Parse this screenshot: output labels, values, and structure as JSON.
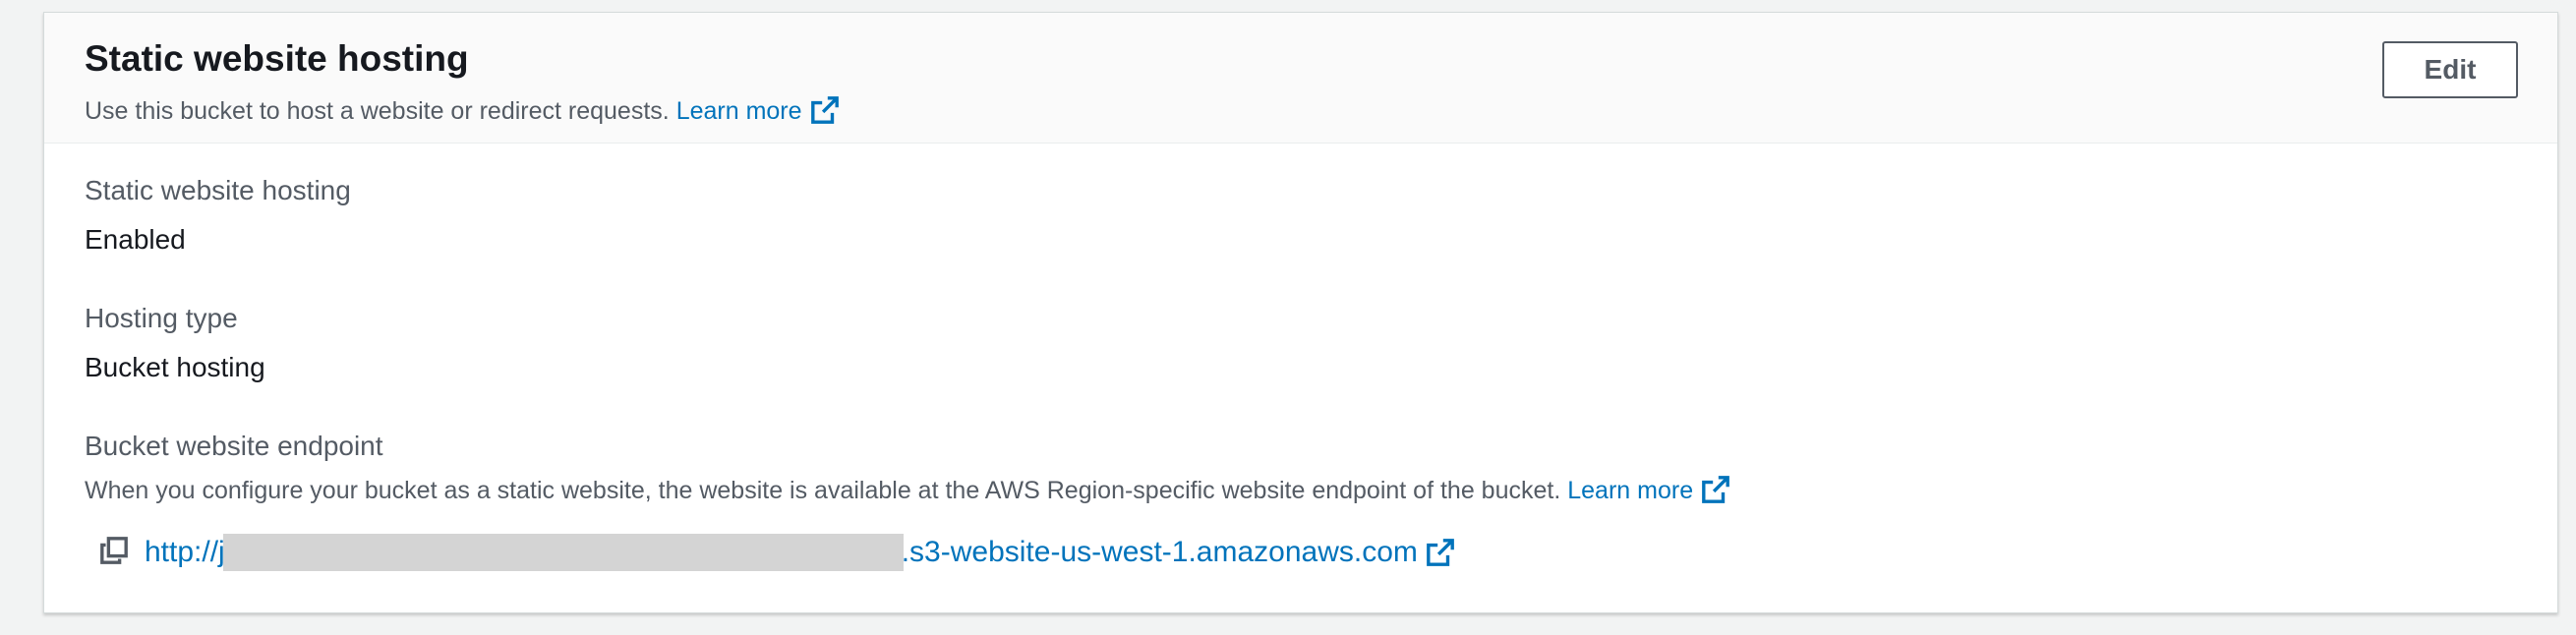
{
  "header": {
    "title": "Static website hosting",
    "description": "Use this bucket to host a website or redirect requests.",
    "learn_more": "Learn more",
    "edit_label": "Edit"
  },
  "fields": {
    "hosting": {
      "label": "Static website hosting",
      "value": "Enabled"
    },
    "hosting_type": {
      "label": "Hosting type",
      "value": "Bucket hosting"
    },
    "endpoint": {
      "label": "Bucket website endpoint",
      "description": "When you configure your bucket as a static website, the website is available at the AWS Region-specific website endpoint of the bucket.",
      "learn_more": "Learn more",
      "url_prefix": "http://j",
      "url_suffix": ".s3-website-us-west-1.amazonaws.com"
    }
  },
  "icons": {
    "external_link": "external-link-icon",
    "copy": "copy-icon"
  },
  "colors": {
    "link": "#0073bb",
    "label": "#545b64",
    "text": "#16191f",
    "redaction": "#d4d4d4"
  }
}
